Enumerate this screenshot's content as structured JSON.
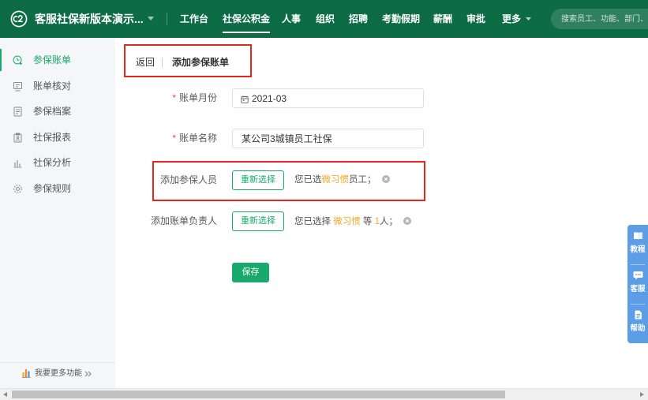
{
  "colors": {
    "brand": "#0d6b46",
    "accent": "#1aa86c",
    "highlight": "#f5a623",
    "required": "#e84b3c",
    "annotation": "#e7261d",
    "help_panel": "#5b9de6"
  },
  "header": {
    "company_name": "客服社保新版本演示...",
    "nav": [
      {
        "label": "工作台",
        "active": false
      },
      {
        "label": "社保公积金",
        "active": true
      },
      {
        "label": "人事",
        "active": false
      },
      {
        "label": "组织",
        "active": false
      },
      {
        "label": "招聘",
        "active": false
      },
      {
        "label": "考勤假期",
        "active": false
      },
      {
        "label": "薪酬",
        "active": false
      },
      {
        "label": "审批",
        "active": false
      },
      {
        "label": "更多",
        "active": false
      }
    ],
    "search_placeholder": "搜索员工、功能、部门、"
  },
  "sidebar": {
    "items": [
      {
        "label": "参保账单",
        "icon": "bill-add-icon",
        "active": true
      },
      {
        "label": "账单核对",
        "icon": "check-bill-icon",
        "active": false
      },
      {
        "label": "参保档案",
        "icon": "archive-icon",
        "active": false
      },
      {
        "label": "社保报表",
        "icon": "report-icon",
        "active": false
      },
      {
        "label": "社保分析",
        "icon": "bar-chart-icon",
        "active": false
      },
      {
        "label": "参保规则",
        "icon": "gear-icon",
        "active": false
      }
    ],
    "footer_label": "我要更多功能"
  },
  "breadcrumb": {
    "back_label": "返回",
    "title": "添加参保账单"
  },
  "form": {
    "required_mark": "*",
    "month": {
      "label": "账单月份",
      "value": "2021-03"
    },
    "name": {
      "label": "账单名称",
      "value": "某公司3城镇员工社保"
    },
    "members": {
      "label": "添加参保人员",
      "button": "重新选择",
      "prefix": "您已选",
      "selected": "微习惯",
      "suffix": "员工；"
    },
    "owner": {
      "label": "添加账单负责人",
      "button": "重新选择",
      "prefix": "您已选择",
      "selected": "微习惯",
      "middle": "等",
      "count": "1",
      "suffix": "人；"
    },
    "save_label": "保存"
  },
  "help_panel": {
    "items": [
      {
        "label": "教程",
        "icon": "tutorial-icon"
      },
      {
        "label": "客服",
        "icon": "chat-icon"
      },
      {
        "label": "帮助",
        "icon": "help-doc-icon"
      }
    ]
  }
}
